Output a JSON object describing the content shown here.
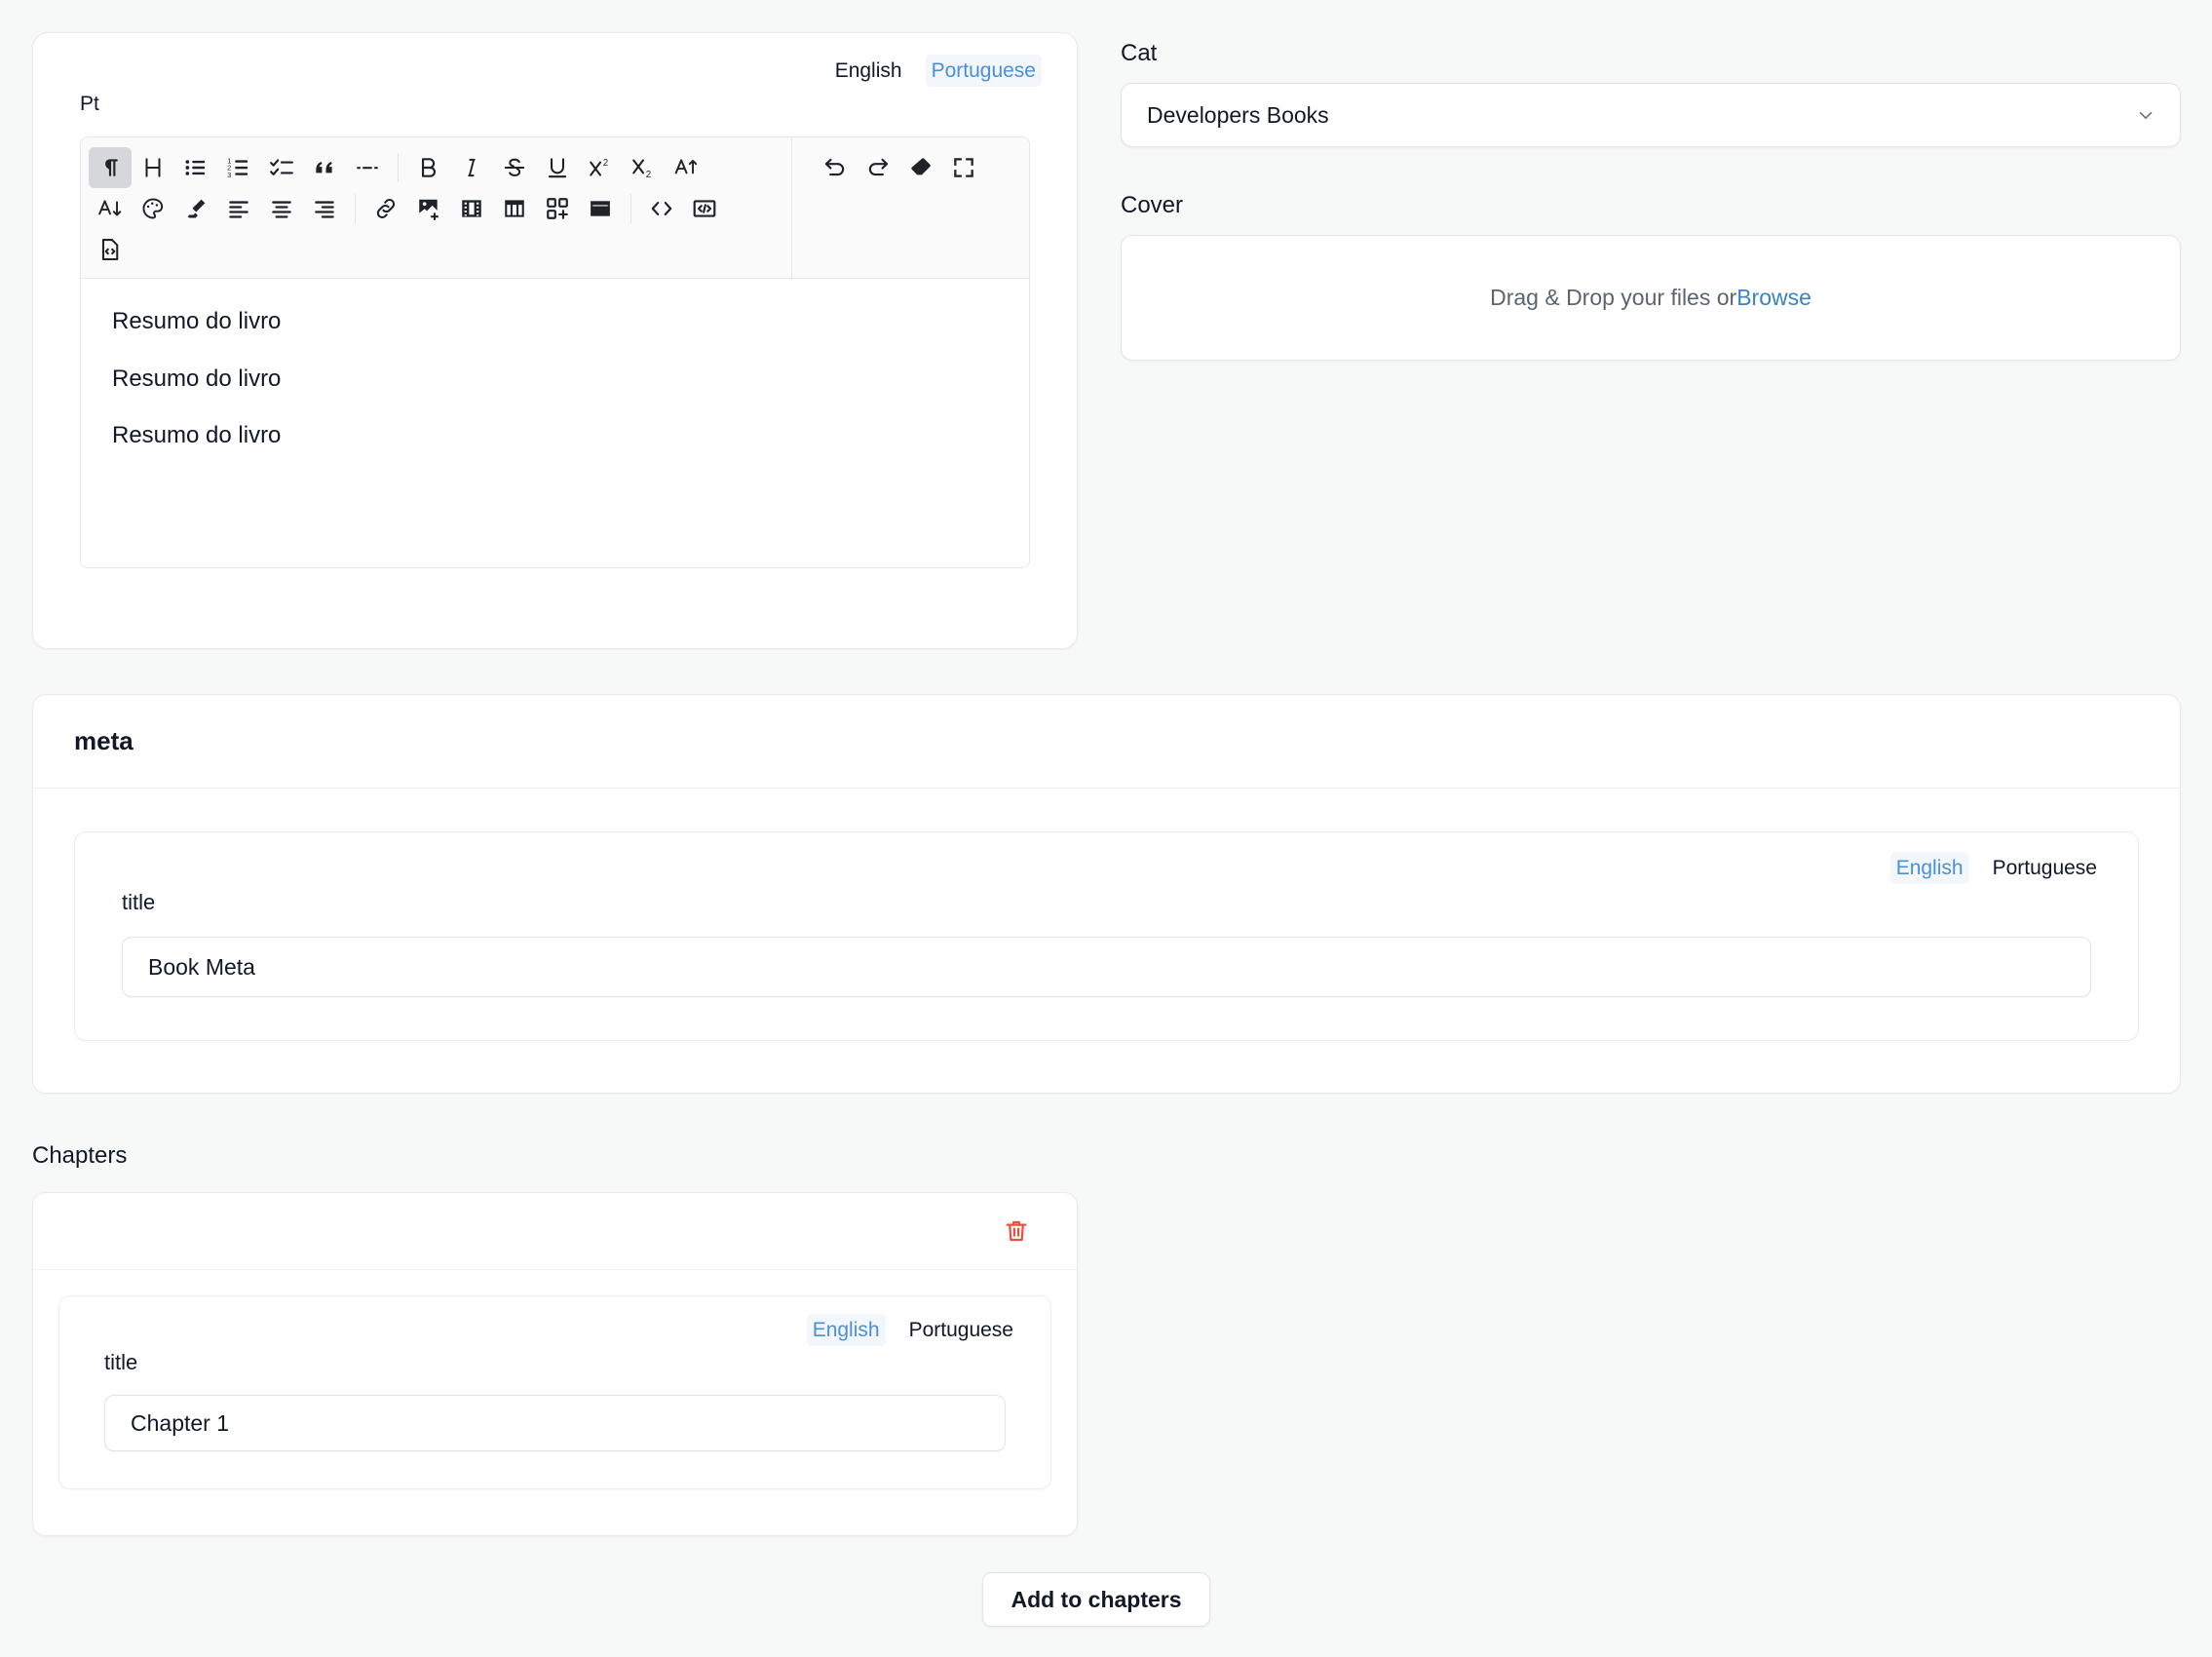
{
  "summary_editor": {
    "lang_tabs": [
      {
        "label": "English",
        "active": false
      },
      {
        "label": "Portuguese",
        "active": true
      }
    ],
    "field_label": "Pt",
    "toolbar": {
      "main_icons": [
        "paragraph-icon",
        "heading-icon",
        "bullet-list-icon",
        "ordered-list-icon",
        "task-list-icon",
        "blockquote-icon",
        "horizontal-rule-icon",
        "bold-icon",
        "italic-icon",
        "strikethrough-icon",
        "underline-icon",
        "superscript-icon",
        "subscript-icon",
        "text-case-icon",
        "font-size-icon",
        "color-palette-icon",
        "highlighter-icon",
        "align-left-icon",
        "align-center-icon",
        "align-right-icon",
        "link-icon",
        "image-icon",
        "video-icon",
        "table-icon",
        "widget-icon",
        "card-icon",
        "inline-code-icon",
        "code-block-icon",
        "source-document-icon"
      ],
      "right_icons": [
        "undo-icon",
        "redo-icon",
        "eraser-icon",
        "fullscreen-icon"
      ]
    },
    "content_paragraphs": [
      "Resumo do livro",
      "Resumo do livro",
      "Resumo do livro"
    ]
  },
  "sidebar": {
    "cat_label": "Cat",
    "cat_value": "Developers Books",
    "cover_label": "Cover",
    "dropzone_text": "Drag & Drop your files or ",
    "dropzone_browse": "Browse"
  },
  "meta_section": {
    "title": "meta",
    "lang_tabs": [
      {
        "label": "English",
        "active": true
      },
      {
        "label": "Portuguese",
        "active": false
      }
    ],
    "field_label": "title",
    "field_value": "Book Meta"
  },
  "chapters": {
    "section_label": "Chapters",
    "delete_icon": "trash-icon",
    "items": [
      {
        "lang_tabs": [
          {
            "label": "English",
            "active": true
          },
          {
            "label": "Portuguese",
            "active": false
          }
        ],
        "field_label": "title",
        "field_value": "Chapter 1"
      }
    ],
    "add_button_label": "Add to chapters"
  },
  "colors": {
    "page_bg": "#f7f8f8",
    "card_bg": "#ffffff",
    "accent_blue": "#4a90d9",
    "link_blue": "#3b82c4",
    "danger_red": "#e8513f",
    "toolbar_bg": "#fafafa"
  }
}
